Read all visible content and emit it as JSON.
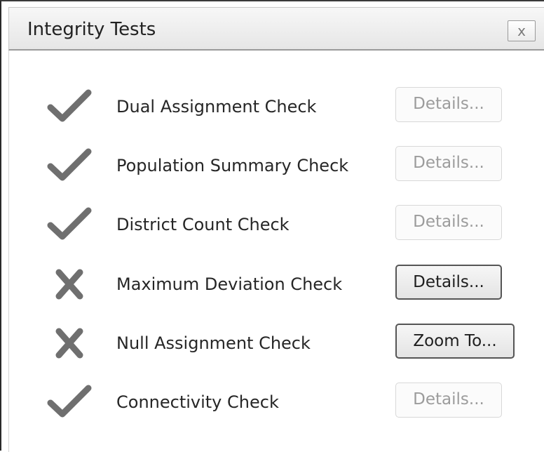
{
  "dialog": {
    "title": "Integrity Tests",
    "close_label": "x"
  },
  "checks": [
    {
      "label": "Dual Assignment Check",
      "status": "pass",
      "status_icon": "check-icon",
      "button_label": "Details...",
      "button_enabled": false
    },
    {
      "label": "Population Summary Check",
      "status": "pass",
      "status_icon": "check-icon",
      "button_label": "Details...",
      "button_enabled": false
    },
    {
      "label": "District Count Check",
      "status": "pass",
      "status_icon": "check-icon",
      "button_label": "Details...",
      "button_enabled": false
    },
    {
      "label": "Maximum Deviation Check",
      "status": "fail",
      "status_icon": "cross-icon",
      "button_label": "Details...",
      "button_enabled": true
    },
    {
      "label": "Null Assignment Check",
      "status": "fail",
      "status_icon": "cross-icon",
      "button_label": "Zoom To...",
      "button_enabled": true
    },
    {
      "label": "Connectivity Check",
      "status": "pass",
      "status_icon": "check-icon",
      "button_label": "Details...",
      "button_enabled": false
    }
  ],
  "colors": {
    "icon": "#6f6f6f",
    "text": "#262626",
    "disabled_text": "#9c9c9c"
  }
}
